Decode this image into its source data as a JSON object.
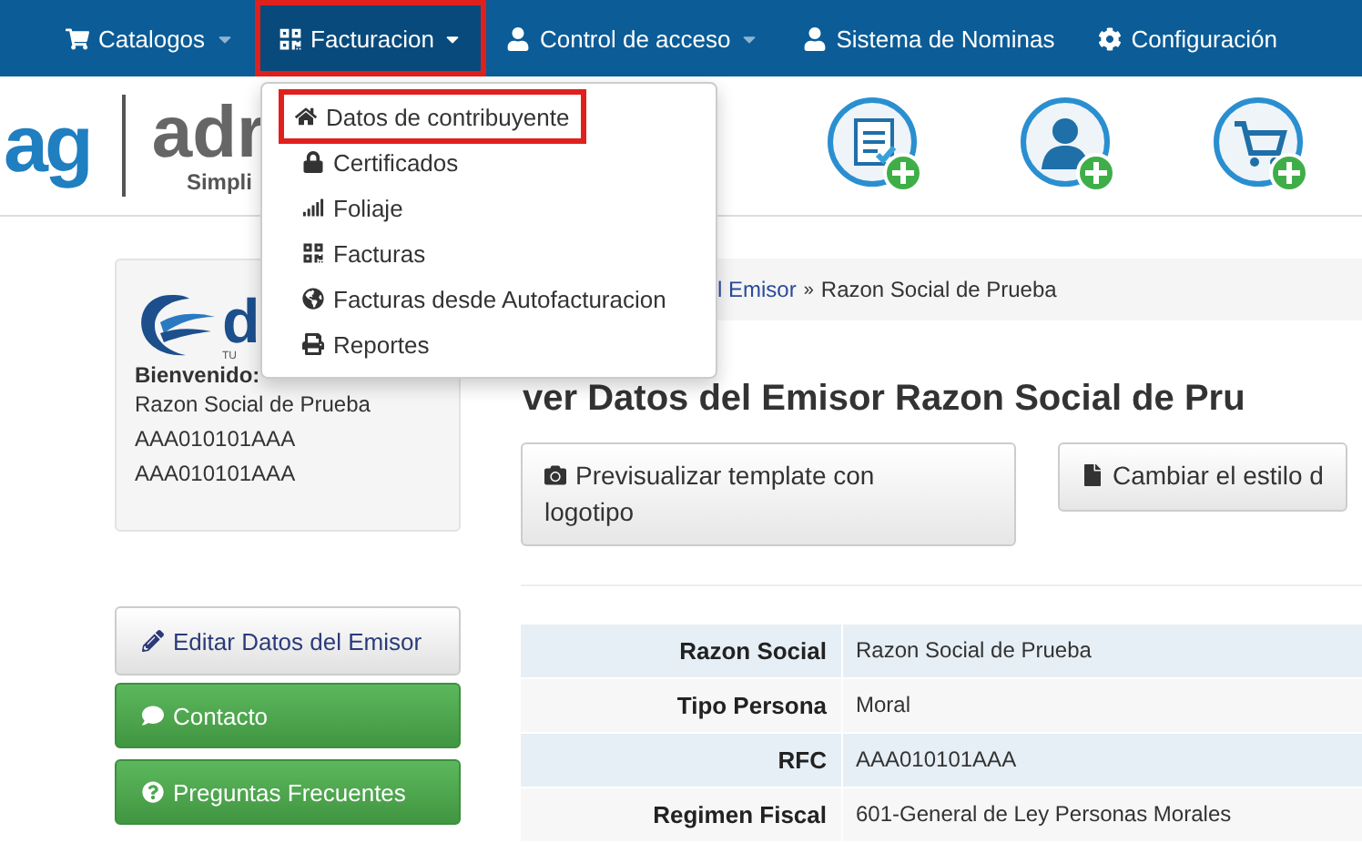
{
  "navbar": {
    "items": [
      {
        "label": "Catalogos",
        "selected": false
      },
      {
        "label": "Facturacion",
        "selected": true
      },
      {
        "label": "Control de acceso",
        "selected": false
      },
      {
        "label": "Sistema de Nominas",
        "selected": false
      },
      {
        "label": "Configuración",
        "selected": false
      }
    ]
  },
  "dropdown": {
    "items": [
      {
        "label": "Datos de contribuyente",
        "selected": true
      },
      {
        "label": "Certificados",
        "selected": false
      },
      {
        "label": "Foliaje",
        "selected": false
      },
      {
        "label": "Facturas",
        "selected": false
      },
      {
        "label": "Facturas desde Autofacturacion",
        "selected": false
      },
      {
        "label": "Reportes",
        "selected": false
      }
    ]
  },
  "header": {
    "logo_mark": "ag",
    "brand": "adr",
    "tagline": "Simpli"
  },
  "sidebar": {
    "card": {
      "logo_letter": "d",
      "logo_small": "TU",
      "welcome": "Bienvenido:",
      "lines": [
        "Razon Social de Prueba",
        "AAA010101AAA",
        "AAA010101AAA"
      ]
    },
    "buttons": [
      {
        "kind": "default",
        "label": "Editar Datos del Emisor"
      },
      {
        "kind": "success",
        "label": "Contacto"
      },
      {
        "kind": "success",
        "label": "Preguntas Frecuentes"
      }
    ]
  },
  "breadcrumb": {
    "link": "l Emisor",
    "separator": "»",
    "current": "Razon Social de Prueba"
  },
  "title": "ver Datos del Emisor Razon Social de Pru",
  "actions": [
    "Previsualizar template con logotipo",
    "Cambiar el estilo d"
  ],
  "details": [
    {
      "label": "Razon Social",
      "value": "Razon Social de Prueba"
    },
    {
      "label": "Tipo Persona",
      "value": "Moral"
    },
    {
      "label": "RFC",
      "value": "AAA010101AAA"
    },
    {
      "label": "Regimen Fiscal",
      "value": "601-General de Ley Personas Morales"
    }
  ]
}
